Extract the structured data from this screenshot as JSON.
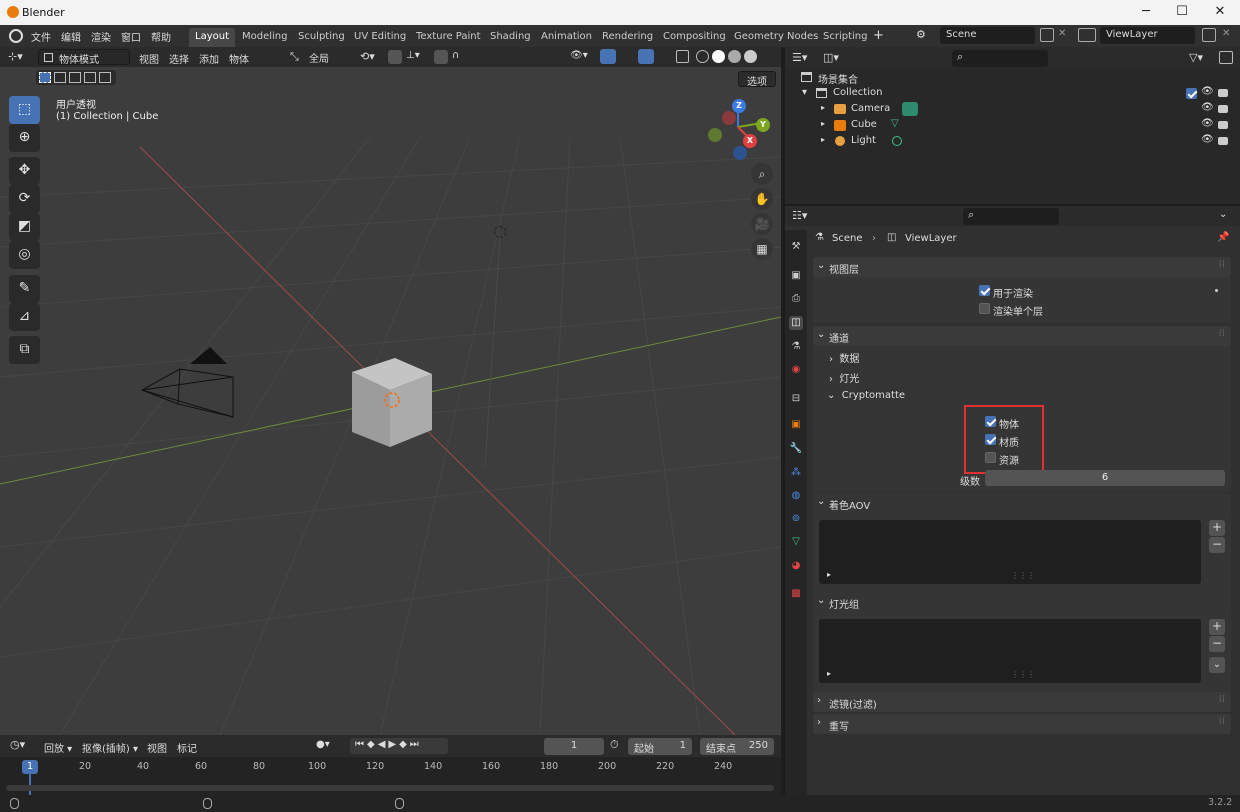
{
  "window": {
    "title": "Blender",
    "minimize": "─",
    "maximize": "☐",
    "close": "✕"
  },
  "menu": [
    "文件",
    "编辑",
    "渲染",
    "窗口",
    "帮助"
  ],
  "workspaces": [
    "Layout",
    "Modeling",
    "Sculpting",
    "UV Editing",
    "Texture Paint",
    "Shading",
    "Animation",
    "Rendering",
    "Compositing",
    "Geometry Nodes",
    "Scripting"
  ],
  "scene_selector": "Scene",
  "viewlayer_selector": "ViewLayer",
  "viewport": {
    "mode": "物体模式",
    "menu": [
      "视图",
      "选择",
      "添加",
      "物体"
    ],
    "transform_orientation": "全局",
    "options_label": "选项",
    "view_name": "用户透视",
    "view_info": "(1) Collection | Cube",
    "gizmo": {
      "z": "Z",
      "y": "Y",
      "x": "X"
    }
  },
  "outliner": {
    "root": "场景集合",
    "collection": "Collection",
    "objects": [
      "Camera",
      "Cube",
      "Light"
    ]
  },
  "properties": {
    "breadcrumb": [
      "Scene",
      "ViewLayer"
    ],
    "viewlayer_panel": {
      "title": "视图层",
      "use_for_render": "用于渲染",
      "render_single_layer": "渲染单个层"
    },
    "passes_panel": {
      "title": "通道",
      "data": "数据",
      "light": "灯光",
      "cryptomatte": "Cryptomatte",
      "object": "物体",
      "material": "材质",
      "asset": "资源",
      "levels_label": "级数",
      "levels_value": "6"
    },
    "shader_aov": "着色AOV",
    "light_groups": "灯光组",
    "filter": "滤镜(过滤)",
    "override": "重写",
    "highlight_color": "#e03030"
  },
  "timeline": {
    "menu": [
      "回放",
      "抠像(插帧)",
      "视图",
      "标记"
    ],
    "current_frame": "1",
    "start_label": "起始",
    "start_value": "1",
    "end_label": "结束点",
    "end_value": "250",
    "ticks": [
      "1",
      "20",
      "40",
      "60",
      "80",
      "100",
      "120",
      "140",
      "160",
      "180",
      "200",
      "220",
      "240"
    ]
  },
  "status": {
    "version": "3.2.2"
  },
  "colors": {
    "accent": "#4772b3",
    "active_orange": "#e87d0d"
  }
}
